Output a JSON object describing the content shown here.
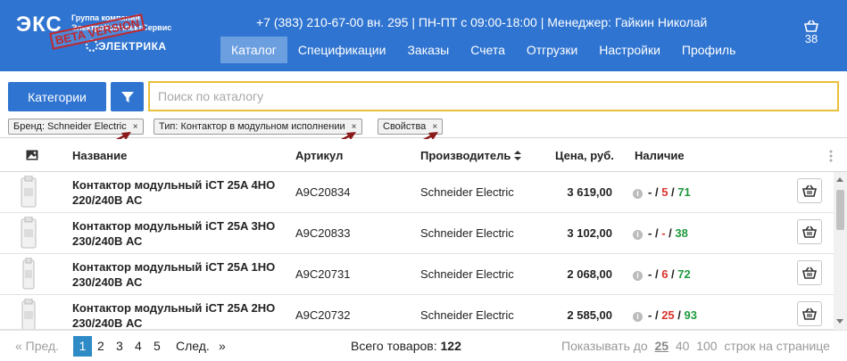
{
  "header": {
    "logo_text": "ЭКС",
    "logo_group_line1": "Группа компаний",
    "logo_group_line2": "ЭлектроКомплектСервис",
    "logo_stamp": "BETA VERSION",
    "logo_brand": "ЭЛЕКТРИКА",
    "contact_info": "+7 (383) 210-67-00 вн. 295 | ПН-ПТ с 09:00-18:00 | Менеджер: Гайкин Николай",
    "nav": [
      {
        "label": "Каталог",
        "active": true
      },
      {
        "label": "Спецификации",
        "active": false
      },
      {
        "label": "Заказы",
        "active": false
      },
      {
        "label": "Счета",
        "active": false
      },
      {
        "label": "Отгрузки",
        "active": false
      },
      {
        "label": "Настройки",
        "active": false
      },
      {
        "label": "Профиль",
        "active": false
      }
    ],
    "cart_count": "38"
  },
  "toolbar": {
    "categories_label": "Категории",
    "search_placeholder": "Поиск по каталогу",
    "search_value": "",
    "filters": [
      {
        "label": "Бренд: Schneider Electric",
        "close": "×"
      },
      {
        "label": "Тип: Контактор в модульном исполнении",
        "close": "×"
      },
      {
        "label": "Свойства",
        "close": "×"
      }
    ]
  },
  "table": {
    "columns": [
      "Название",
      "Артикул",
      "Производитель",
      "Цена, руб.",
      "Наличие"
    ],
    "rows": [
      {
        "name": "Контактор модульный iCT 25A 4НО 220/240В АС",
        "article": "A9C20834",
        "manufacturer": "Schneider Electric",
        "price": "3 619,00",
        "stock": [
          "-",
          "5",
          "71"
        ]
      },
      {
        "name": "Контактор модульный iCT 25A 3НО 230/240В АС",
        "article": "A9C20833",
        "manufacturer": "Schneider Electric",
        "price": "3 102,00",
        "stock": [
          "-",
          "-",
          "38"
        ]
      },
      {
        "name": "Контактор модульный iCT 25A 1НО 230/240В АС",
        "article": "A9C20731",
        "manufacturer": "Schneider Electric",
        "price": "2 068,00",
        "stock": [
          "-",
          "6",
          "72"
        ]
      },
      {
        "name": "Контактор модульный iCT 25A 2НО 230/240В АС",
        "article": "A9C20732",
        "manufacturer": "Schneider Electric",
        "price": "2 585,00",
        "stock": [
          "-",
          "25",
          "93"
        ]
      }
    ]
  },
  "pagination": {
    "prev": "« Пред.",
    "pages": [
      "1",
      "2",
      "3",
      "4",
      "5"
    ],
    "current": "1",
    "next": "След.",
    "next_arrow": "»",
    "total_label": "Всего товаров:",
    "total_value": "122",
    "perpage_label": "Показывать до",
    "perpage_options": [
      "25",
      "40",
      "100"
    ],
    "perpage_selected": "25",
    "perpage_suffix": "строк на странице"
  },
  "colors": {
    "header_bg": "#2f74d0",
    "nav_active_bg": "#6b9fe0",
    "search_border": "#e9c03a",
    "stock_red": "#d9332b",
    "stock_green": "#1e9a3e",
    "page_active": "#2f8bc6",
    "annotation_arrow": "#8b1a1a"
  }
}
